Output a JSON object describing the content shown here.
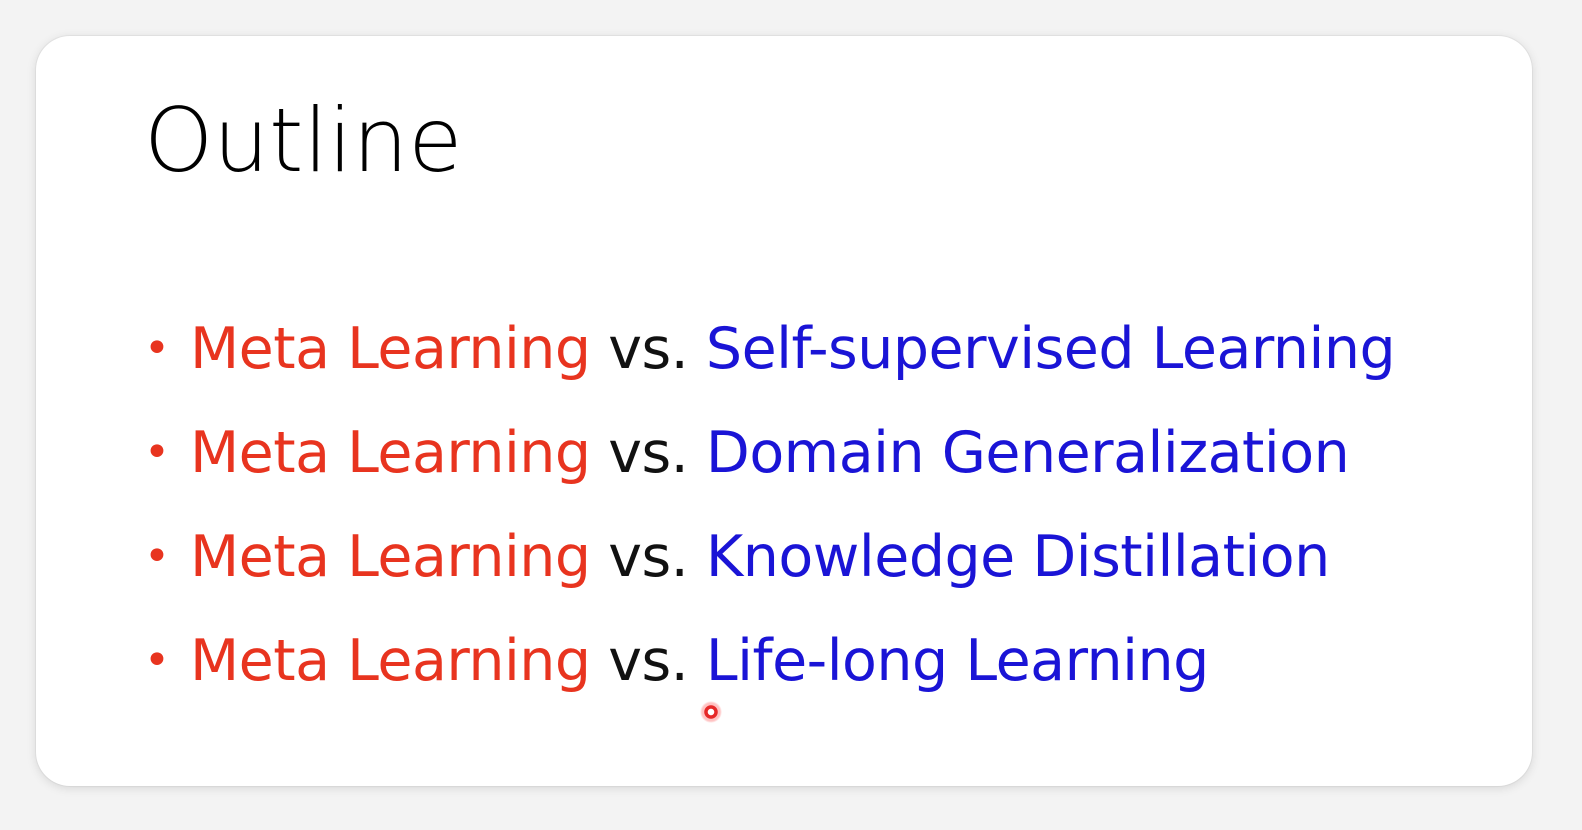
{
  "slide": {
    "title": "Outline",
    "bullet_symbol": "•",
    "bullets": [
      {
        "left": "Meta Learning",
        "connector": "vs.",
        "right": "Self-supervised Learning"
      },
      {
        "left": "Meta Learning",
        "connector": "vs.",
        "right": "Domain Generalization"
      },
      {
        "left": "Meta Learning",
        "connector": "vs.",
        "right": "Knowledge Distillation"
      },
      {
        "left": "Meta Learning",
        "connector": "vs.",
        "right": "Life-long Learning"
      }
    ]
  },
  "colors": {
    "left_term": "#e8341f",
    "connector": "#111111",
    "right_term": "#1a14d6"
  }
}
